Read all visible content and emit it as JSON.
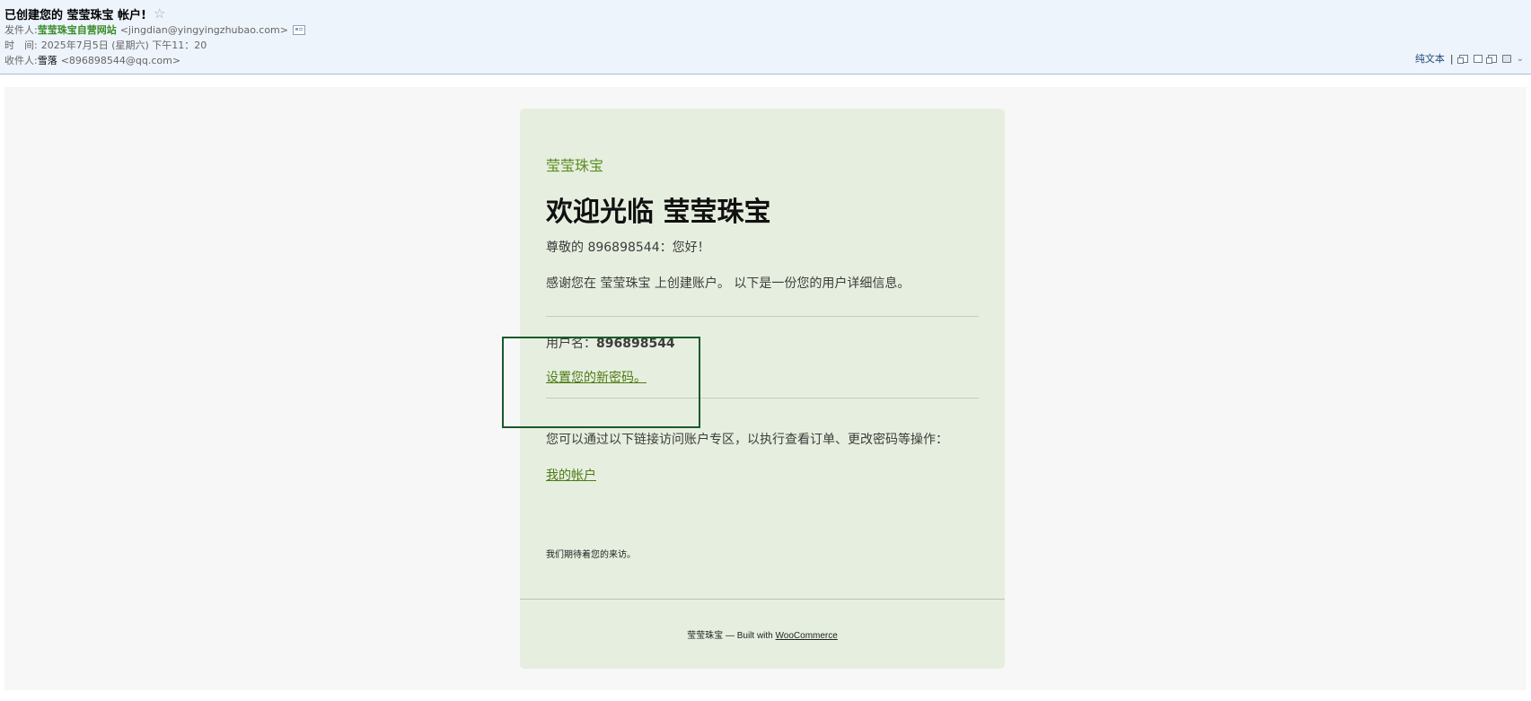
{
  "header": {
    "subject": "已创建您的 莹莹珠宝 帐户!",
    "star_glyph": "☆",
    "from_label": "发件人:",
    "from_name": "莹莹珠宝自营网站",
    "from_address": "<jingdian@yingyingzhubao.com>",
    "time_label": "时　间:",
    "time_value": "2025年7月5日 (星期六) 下午11：20",
    "to_label": "收件人:",
    "to_name": "雪落",
    "to_address": "<896898544@qq.com>",
    "plaintext_label": "纯文本",
    "tool_separator": "|",
    "more_glyph": "⌄"
  },
  "email": {
    "brand": "莹莹珠宝",
    "title": "欢迎光临 莹莹珠宝",
    "greeting": "尊敬的 896898544：您好！",
    "thanks": "感谢您在 莹莹珠宝 上创建账户。 以下是一份您的用户详细信息。",
    "username_label": "用户名：",
    "username_value": "896898544",
    "set_password_link": "设置您的新密码。",
    "account_text": "您可以通过以下链接访问账户专区，以执行查看订单、更改密码等操作：",
    "my_account_link": "我的帐户",
    "closing": "我们期待着您的来访。",
    "footer_prefix": "莹莹珠宝 — Built with ",
    "footer_link": "WooCommerce"
  },
  "colors": {
    "accent": "#5c8b22",
    "highlight_box": "#1b5a2b",
    "card_bg": "#e6efdf"
  }
}
